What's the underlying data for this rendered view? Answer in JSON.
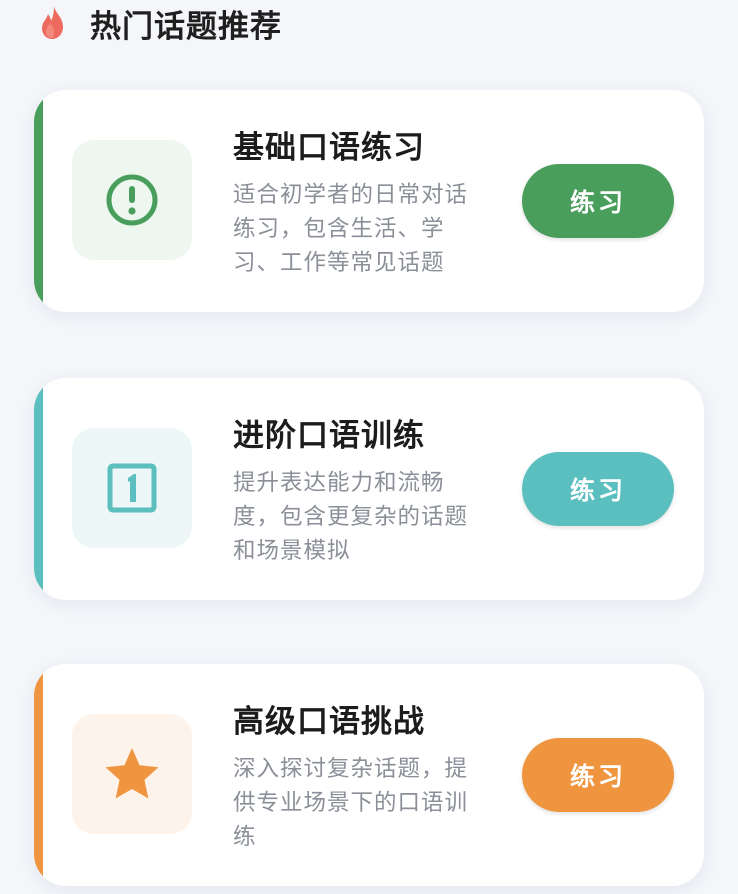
{
  "header": {
    "title": "热门话题推荐",
    "icon": "fire-icon"
  },
  "topics": [
    {
      "title": "基础口语练习",
      "description": "适合初学者的日常对话练习，包含生活、学习、工作等常见话题",
      "button_label": "练习",
      "icon": "exclamation-circle-icon",
      "accent_color": "#4a9e5c",
      "icon_bg": "#edf6ef"
    },
    {
      "title": "进阶口语训练",
      "description": "提升表达能力和流畅度，包含更复杂的话题和场景模拟",
      "button_label": "练习",
      "icon": "number-one-box-icon",
      "accent_color": "#5bbfc0",
      "icon_bg": "#eef7f8"
    },
    {
      "title": "高级口语挑战",
      "description": "深入探讨复杂话题，提供专业场景下的口语训练",
      "button_label": "练习",
      "icon": "star-icon",
      "accent_color": "#f0953f",
      "icon_bg": "#fdf3ea"
    }
  ]
}
